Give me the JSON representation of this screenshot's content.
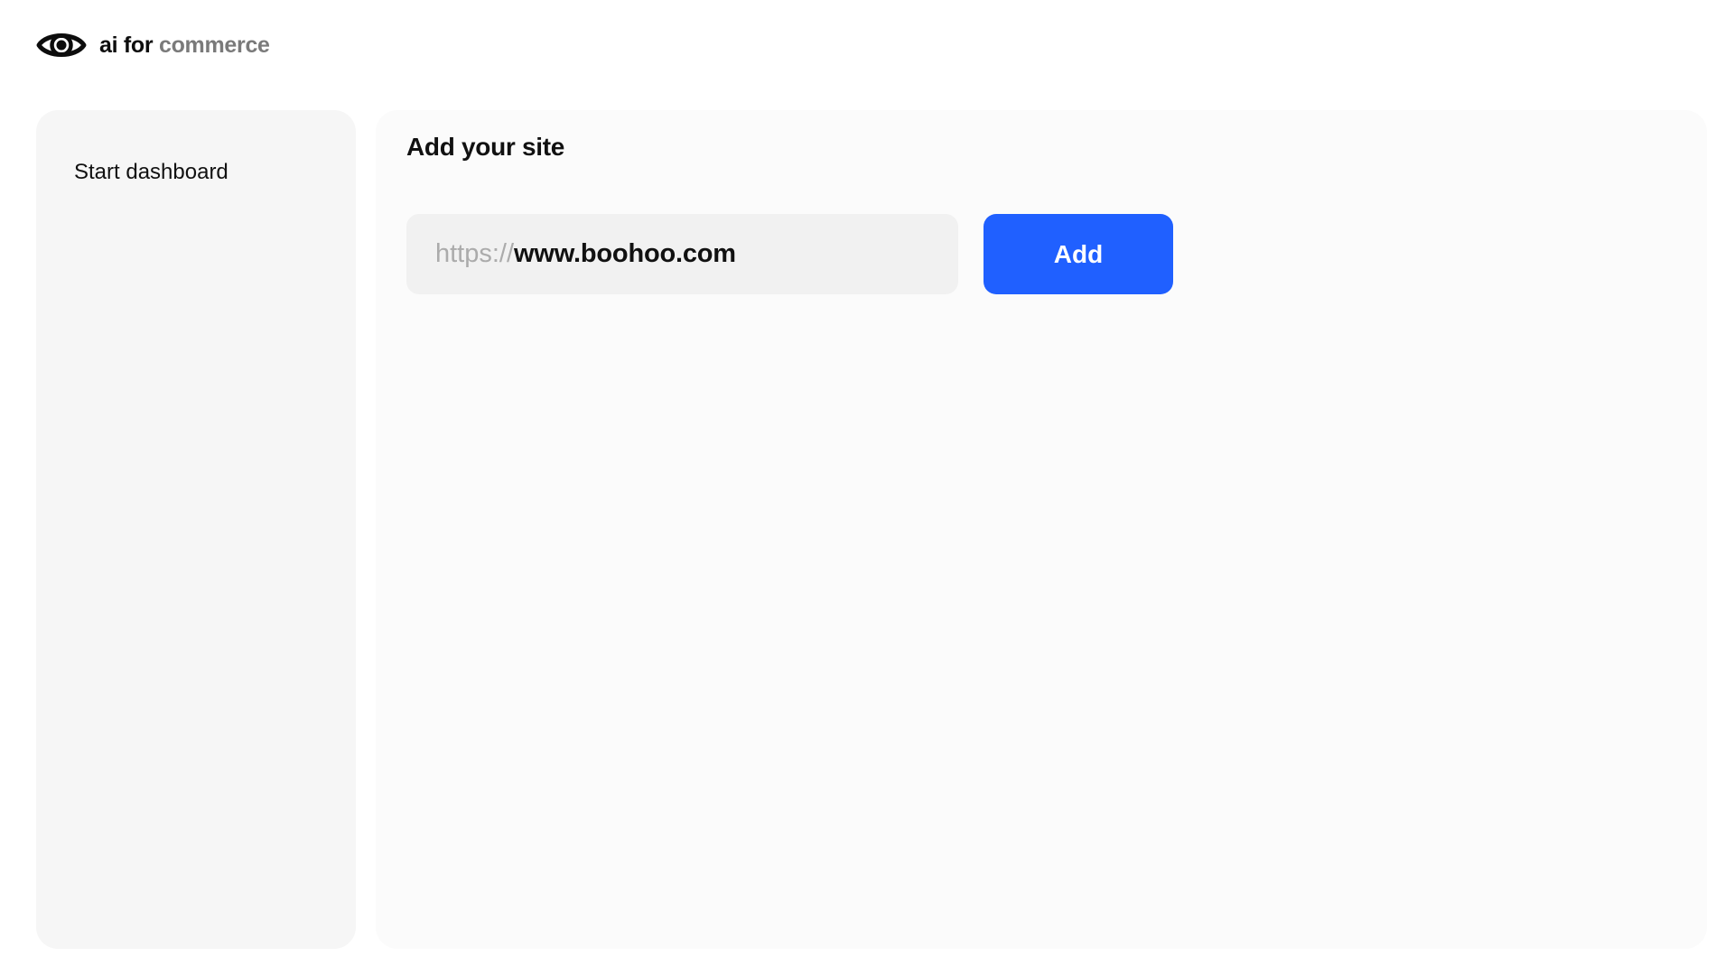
{
  "brand": {
    "name_primary": "ai for",
    "name_secondary": "commerce",
    "logo_icon": "eye-icon"
  },
  "sidebar": {
    "items": [
      {
        "label": "Start dashboard"
      }
    ]
  },
  "main": {
    "title": "Add your site",
    "url_input": {
      "prefix": "https://",
      "value": "www.boohoo.com"
    },
    "add_button_label": "Add"
  },
  "colors": {
    "accent": "#2060ff",
    "sidebar_bg": "#f6f6f6",
    "panel_bg": "#fbfbfb",
    "input_bg": "#f1f1f1",
    "muted_text": "#7a7a7a"
  }
}
